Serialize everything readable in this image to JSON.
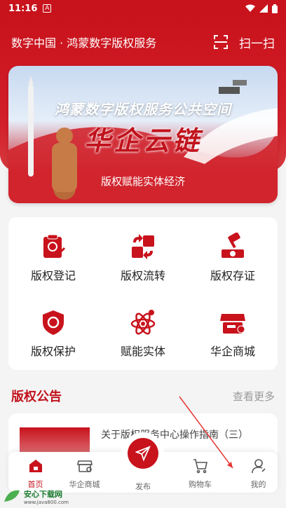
{
  "status_bar": {
    "time": "11:16",
    "badge": "A"
  },
  "header": {
    "title": "数字中国 · 鸿蒙数字版权服务",
    "scan_label": "扫一扫"
  },
  "banner": {
    "subtitle": "鸿蒙数字版权服务公共空间",
    "title": "华企云链",
    "slogan": "版权赋能实体经济"
  },
  "services": [
    {
      "label": "版权登记",
      "icon": "copyright-register-icon"
    },
    {
      "label": "版权流转",
      "icon": "copyright-transfer-icon"
    },
    {
      "label": "版权存证",
      "icon": "copyright-evidence-icon"
    },
    {
      "label": "版权保护",
      "icon": "copyright-protect-icon"
    },
    {
      "label": "赋能实体",
      "icon": "empower-entity-icon"
    },
    {
      "label": "华企商城",
      "icon": "mall-icon"
    }
  ],
  "announcements": {
    "title": "版权公告",
    "more_label": "查看更多",
    "items": [
      {
        "text": "关于版权服务中心操作指南（三）"
      }
    ]
  },
  "tab_bar": {
    "tabs": [
      {
        "label": "首页",
        "icon": "home-icon",
        "active": true
      },
      {
        "label": "华企商城",
        "icon": "mall-icon",
        "active": false
      },
      {
        "label": "发布",
        "icon": "publish-icon",
        "active": false
      },
      {
        "label": "购物车",
        "icon": "cart-icon",
        "active": false
      },
      {
        "label": "我的",
        "icon": "profile-icon",
        "active": false
      }
    ]
  },
  "watermark": {
    "name": "安心下载网",
    "url": "www.java800.com"
  },
  "colors": {
    "brand": "#c8121c",
    "accent_text": "#c1131d",
    "muted": "#999999"
  }
}
